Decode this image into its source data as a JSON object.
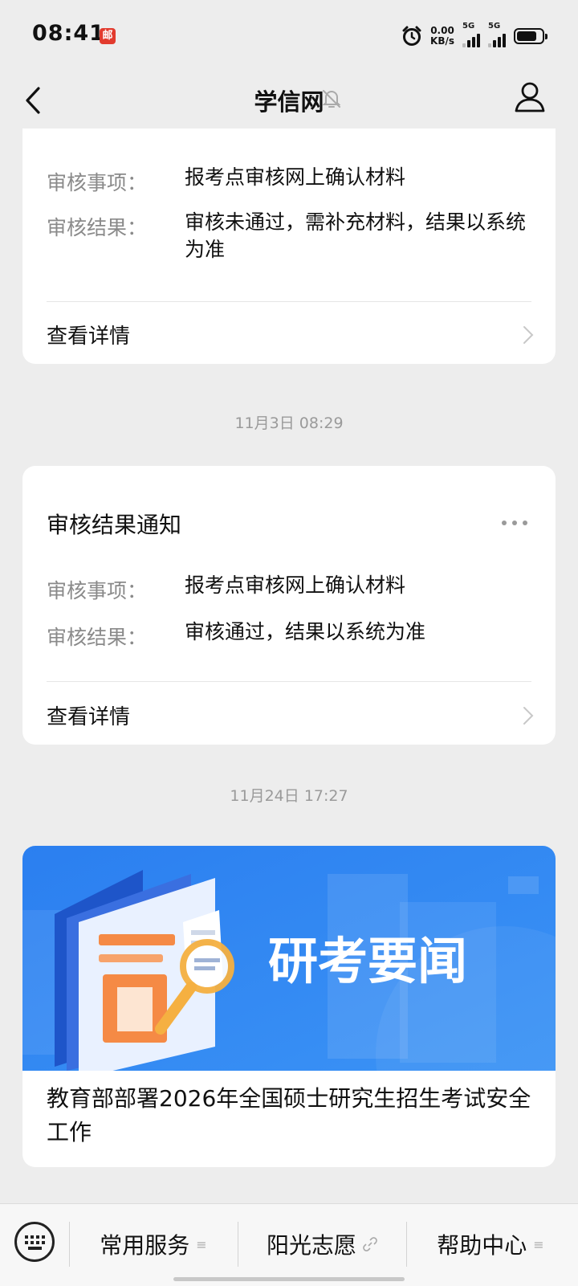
{
  "status_bar": {
    "time": "08:41",
    "app_badge": "邮",
    "net_speed_value": "0.00",
    "net_speed_unit": "KB/s",
    "sim1": "5G",
    "sim2": "5G"
  },
  "nav": {
    "title": "学信网"
  },
  "messages": [
    {
      "items": [
        {
          "label": "审核事项：",
          "value": "报考点审核网上确认材料"
        },
        {
          "label": "审核结果：",
          "value": "审核未通过，需补充材料，结果以系统为准"
        }
      ],
      "link": "查看详情"
    },
    {
      "timestamp": "11月3日 08:29",
      "title": "审核结果通知",
      "items": [
        {
          "label": "审核事项：",
          "value": "报考点审核网上确认材料"
        },
        {
          "label": "审核结果：",
          "value": "审核通过，结果以系统为准"
        }
      ],
      "link": "查看详情"
    }
  ],
  "article": {
    "timestamp": "11月24日 17:27",
    "banner_text": "研考要闻",
    "title": "教育部部署2026年全国硕士研究生招生考试安全工作"
  },
  "bottom_menu": [
    {
      "label": "常用服务",
      "icon": "menu-lines-icon"
    },
    {
      "label": "阳光志愿",
      "icon": "link-icon"
    },
    {
      "label": "帮助中心",
      "icon": "menu-lines-icon"
    }
  ],
  "colors": {
    "background": "#ededed",
    "banner_blue": "#2f86f0",
    "banner_orange": "#f58a45"
  }
}
